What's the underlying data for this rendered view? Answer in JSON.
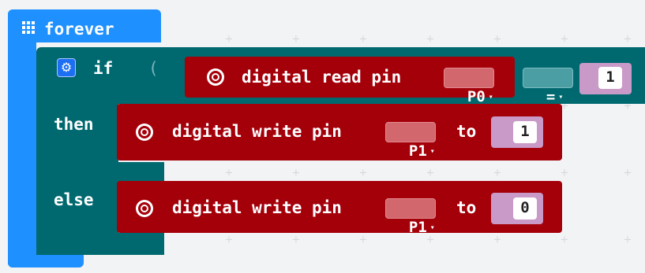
{
  "forever_block": {
    "label": "forever",
    "icon": "grid-icon",
    "color": "#1e90ff"
  },
  "if_block": {
    "if_label": "if",
    "then_label": "then",
    "else_label": "else",
    "icon": "gear-icon",
    "color": "#006970",
    "paren": "("
  },
  "condition": {
    "read_label": "digital read pin",
    "read_pin": "P0",
    "operator": "=",
    "compare_value": "1"
  },
  "then_action": {
    "label": "digital write pin",
    "pin": "P1",
    "to_label": "to",
    "value": "1"
  },
  "else_action": {
    "label": "digital write pin",
    "pin": "P1",
    "to_label": "to",
    "value": "0"
  },
  "caret": "▾",
  "colors": {
    "pins_block": "#a4000a",
    "logic_block": "#006970",
    "loop_block": "#1e90ff",
    "workspace": "#f2f3f5"
  }
}
